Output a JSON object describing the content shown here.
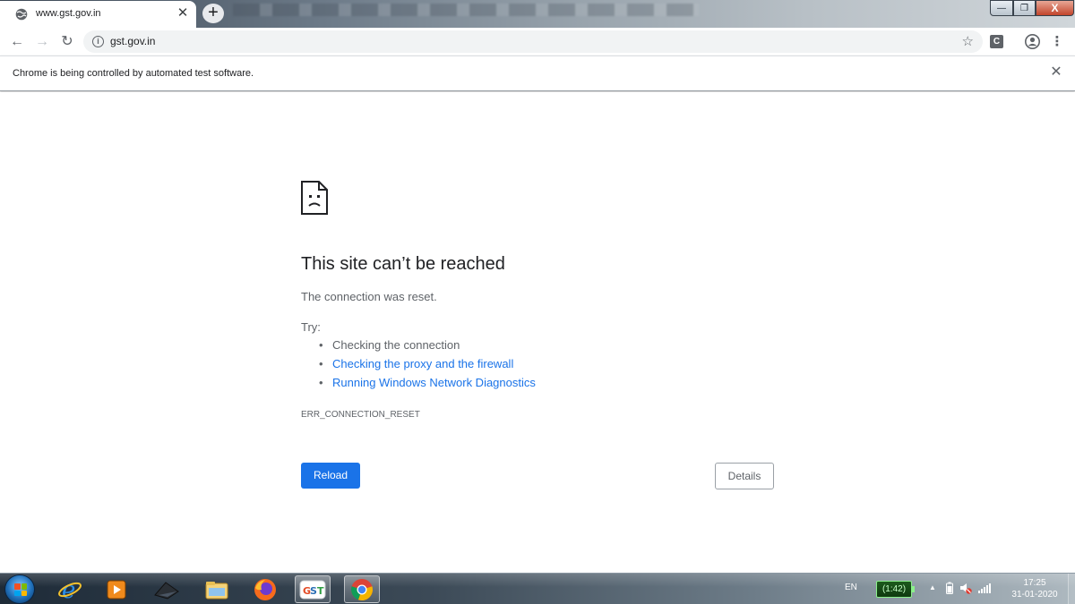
{
  "browser": {
    "tab": {
      "title": "www.gst.gov.in"
    },
    "new_tab_label": "+",
    "window_controls": {
      "minimize": "—",
      "maximize": "❐",
      "close": "X"
    },
    "toolbar": {
      "url": "gst.gov.in",
      "extension_label": "C"
    },
    "infobar": {
      "message": "Chrome is being controlled by automated test software."
    }
  },
  "error_page": {
    "title": "This site can’t be reached",
    "subtitle": "The connection was reset.",
    "try_label": "Try:",
    "suggestions": [
      {
        "text": "Checking the connection",
        "is_link": false
      },
      {
        "text": "Checking the proxy and the firewall",
        "is_link": true
      },
      {
        "text": "Running Windows Network Diagnostics",
        "is_link": true
      }
    ],
    "error_code": "ERR_CONNECTION_RESET",
    "reload_label": "Reload",
    "details_label": "Details"
  },
  "taskbar": {
    "language": "EN",
    "battery_time": "(1:42)",
    "clock_time": "17:25",
    "clock_date": "31-01-2020",
    "pinned_icons": [
      "internet-explorer-icon",
      "media-player-icon",
      "folder-app-icon",
      "file-explorer-icon",
      "firefox-icon",
      "gst-app-icon",
      "chrome-icon"
    ]
  },
  "colors": {
    "link": "#1a73e8",
    "primary_button": "#1a73e8",
    "text_primary": "#202124",
    "text_secondary": "#5f6368"
  }
}
